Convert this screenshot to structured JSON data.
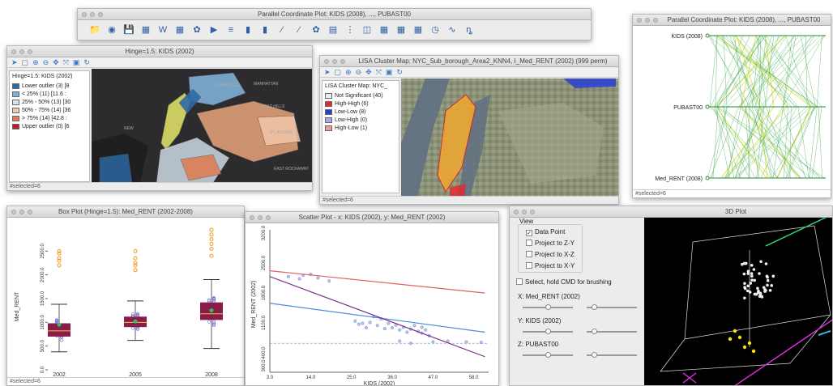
{
  "main_toolbar": {
    "title": "Parallel Coordinate Plot: KIDS (2008), ..., PUBAST00",
    "icons": [
      "📁",
      "◉",
      "💾",
      "▦",
      "W",
      "▦",
      "✿",
      "▶",
      "≡",
      "▮",
      "▮",
      "⁄",
      "⁄",
      "✿",
      "▤",
      "⋮",
      "◫",
      "▦",
      "▦",
      "▦",
      "◷",
      "∿",
      "ȵ"
    ]
  },
  "hinge_map": {
    "title": "Hinge=1.5: KIDS (2002)",
    "legend_title": "Hinge=1.5: KIDS (2002)",
    "legend": [
      {
        "label": "Lower outlier (3) [8",
        "color": "#2c6aa8"
      },
      {
        "label": "< 25% (11) [11.6 :",
        "color": "#7fb0d6"
      },
      {
        "label": "25% - 50% (13) [30",
        "color": "#d6e4ee"
      },
      {
        "label": "50% - 75% (14) [36",
        "color": "#f2c7a8"
      },
      {
        "label": "> 75% (14) [42.8 :",
        "color": "#e07a50"
      },
      {
        "label": "Upper outlier (0) [6",
        "color": "#b3232e"
      }
    ],
    "status": "#selected=6"
  },
  "lisa_map": {
    "title": "LISA Cluster Map: NYC_Sub_borough_Area2_KNN4, I_Med_RENT (2002) (999 perm)",
    "legend_title": "LISA Cluster Map: NYC_",
    "legend": [
      {
        "label": "Not Significant (40)",
        "color": "#eeeeee"
      },
      {
        "label": "High-High (6)",
        "color": "#e8262b"
      },
      {
        "label": "Low-Low (8)",
        "color": "#2a3fd6"
      },
      {
        "label": "Low-High (0)",
        "color": "#a7a7ee"
      },
      {
        "label": "High-Low (1)",
        "color": "#f29a9a"
      }
    ],
    "status": "#selected=6"
  },
  "pcp": {
    "title": "Parallel Coordinate Plot: KIDS (2008), ..., PUBAST00",
    "axes": [
      "KIDS (2008)",
      "PUBAST00",
      "Med_RENT (2008)"
    ],
    "status": "#selected=6"
  },
  "box_plot": {
    "title": "Box Plot (Hinge=1.5): Med_RENT (2002-2008)",
    "ylabel": "Med_RENT",
    "status": "#selected=6"
  },
  "scatter": {
    "title": "Scatter Plot - x: KIDS (2002), y: Med_RENT (2002)",
    "xlabel": "KIDS (2002)",
    "ylabel": "Med_RENT (2002)"
  },
  "plot3d_panel": {
    "view_label": "View",
    "options": [
      {
        "label": "Data Point",
        "checked": "✓"
      },
      {
        "label": "Project to Z-Y",
        "checked": ""
      },
      {
        "label": "Project to X-Z",
        "checked": ""
      },
      {
        "label": "Project to X-Y",
        "checked": ""
      }
    ],
    "brush_label": "Select, hold CMD for brushing",
    "x_label": "X: Med_RENT (2002)",
    "y_label": "Y: KIDS (2002)",
    "z_label": "Z: PUBAST00",
    "title": "3D Plot"
  },
  "chart_data": [
    {
      "type": "box",
      "title": "Box Plot (Hinge=1.5): Med_RENT (2002-2008)",
      "ylabel": "Med_RENT",
      "categories": [
        "2002",
        "2005",
        "2008"
      ],
      "ylim": [
        0,
        3000
      ],
      "yticks": [
        "0.0",
        "500.0",
        "1000.0",
        "1500.0",
        "2000.0",
        "2500.0"
      ],
      "boxes": [
        {
          "category": "2002",
          "min": 380,
          "q1": 700,
          "median": 820,
          "mean": 950,
          "q3": 980,
          "max": 1380,
          "outliers": [
            2200,
            2300,
            2350,
            2450,
            2500
          ]
        },
        {
          "category": "2005",
          "min": 620,
          "q1": 900,
          "median": 1000,
          "mean": 1020,
          "q3": 1120,
          "max": 1450,
          "outliers": [
            2100,
            2200,
            2250,
            2350,
            2500
          ]
        },
        {
          "category": "2008",
          "min": 450,
          "q1": 1050,
          "median": 1180,
          "mean": 1250,
          "q3": 1420,
          "max": 1900,
          "outliers": [
            2400,
            2550,
            2650,
            2750,
            2850,
            2950
          ]
        }
      ]
    },
    {
      "type": "scatter",
      "title": "Scatter Plot - x: KIDS (2002), y: Med_RENT (2002)",
      "xlabel": "KIDS (2002)",
      "ylabel": "Med_RENT (2002)",
      "xlim": [
        3,
        62
      ],
      "ylim": [
        0,
        3200
      ],
      "xticks": [
        "3.0",
        "14.0",
        "25.0",
        "36.0",
        "47.0",
        "58.0"
      ],
      "yticks": [
        "300.0",
        "400.0",
        "1100.0",
        "1800.0",
        "2500.0",
        "3200.0"
      ],
      "points": [
        [
          8,
          2150
        ],
        [
          11,
          2100
        ],
        [
          12,
          2180
        ],
        [
          14,
          2200
        ],
        [
          16,
          2120
        ],
        [
          19,
          2050
        ],
        [
          26,
          1150
        ],
        [
          28,
          1100
        ],
        [
          30,
          1120
        ],
        [
          32,
          1050
        ],
        [
          34,
          980
        ],
        [
          35,
          1100
        ],
        [
          36,
          1000
        ],
        [
          37,
          1060
        ],
        [
          38,
          950
        ],
        [
          39,
          1010
        ],
        [
          40,
          900
        ],
        [
          41,
          970
        ],
        [
          42,
          1050
        ],
        [
          43,
          920
        ],
        [
          44,
          880
        ],
        [
          45,
          950
        ],
        [
          46,
          820
        ],
        [
          44,
          1010
        ],
        [
          33,
          1200
        ],
        [
          31,
          1250
        ],
        [
          27,
          1080
        ],
        [
          29,
          1000
        ],
        [
          47,
          680
        ],
        [
          51,
          700
        ],
        [
          56,
          680
        ],
        [
          60,
          670
        ],
        [
          38,
          700
        ],
        [
          41,
          650
        ]
      ],
      "regression_lines": [
        {
          "color": "#e06060",
          "x": [
            3,
            61
          ],
          "y": [
            2280,
            1780
          ]
        },
        {
          "color": "#4a8ed8",
          "x": [
            3,
            61
          ],
          "y": [
            1550,
            900
          ]
        },
        {
          "color": "#7a2a8a",
          "x": [
            3,
            61
          ],
          "y": [
            2150,
            350
          ]
        }
      ]
    }
  ]
}
